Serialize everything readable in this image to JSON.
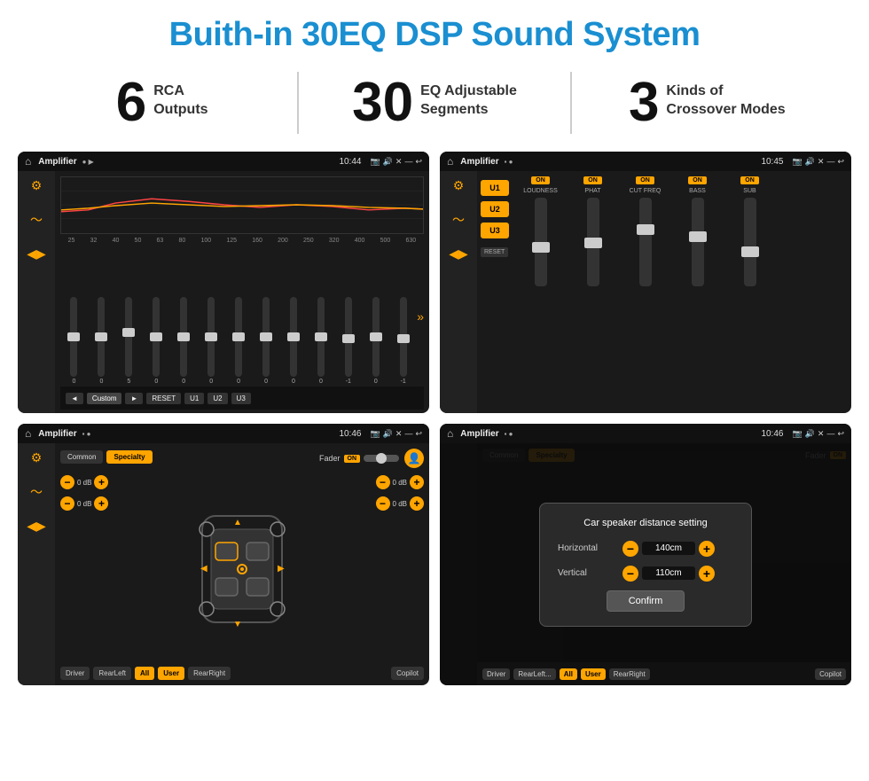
{
  "header": {
    "title": "Buith-in 30EQ DSP Sound System"
  },
  "stats": [
    {
      "number": "6",
      "label_line1": "RCA",
      "label_line2": "Outputs"
    },
    {
      "number": "30",
      "label_line1": "EQ Adjustable",
      "label_line2": "Segments"
    },
    {
      "number": "3",
      "label_line1": "Kinds of",
      "label_line2": "Crossover Modes"
    }
  ],
  "screens": [
    {
      "id": "screen1",
      "status": {
        "app": "Amplifier",
        "time": "10:44"
      },
      "type": "eq",
      "bottom_buttons": [
        "◄",
        "Custom",
        "►",
        "RESET",
        "U1",
        "U2",
        "U3"
      ],
      "freq_labels": [
        "25",
        "32",
        "40",
        "50",
        "63",
        "80",
        "100",
        "125",
        "160",
        "200",
        "250",
        "320",
        "400",
        "500",
        "630"
      ]
    },
    {
      "id": "screen2",
      "status": {
        "app": "Amplifier",
        "time": "10:45"
      },
      "type": "amp",
      "presets": [
        "U1",
        "U2",
        "U3"
      ],
      "channels": [
        {
          "name": "LOUDNESS",
          "toggle": "ON"
        },
        {
          "name": "PHAT",
          "toggle": "ON"
        },
        {
          "name": "CUT FREQ",
          "toggle": "ON"
        },
        {
          "name": "BASS",
          "toggle": "ON"
        },
        {
          "name": "SUB",
          "toggle": "ON"
        }
      ],
      "reset_btn": "RESET"
    },
    {
      "id": "screen3",
      "status": {
        "app": "Amplifier",
        "time": "10:46"
      },
      "type": "speaker",
      "tabs": [
        "Common",
        "Specialty"
      ],
      "fader_label": "Fader",
      "fader_on": "ON",
      "bottom_buttons": [
        "Driver",
        "RearLeft",
        "All",
        "User",
        "RearRight",
        "Copilot"
      ],
      "vol_controls": [
        "0 dB",
        "0 dB",
        "0 dB",
        "0 dB"
      ]
    },
    {
      "id": "screen4",
      "status": {
        "app": "Amplifier",
        "time": "10:46"
      },
      "type": "dialog",
      "dialog": {
        "title": "Car speaker distance setting",
        "horizontal_label": "Horizontal",
        "horizontal_value": "140cm",
        "vertical_label": "Vertical",
        "vertical_value": "110cm",
        "confirm_btn": "Confirm"
      },
      "bottom_buttons": [
        "Driver",
        "RearLeft...",
        "All",
        "User",
        "RearRight",
        "Copilot"
      ]
    }
  ]
}
